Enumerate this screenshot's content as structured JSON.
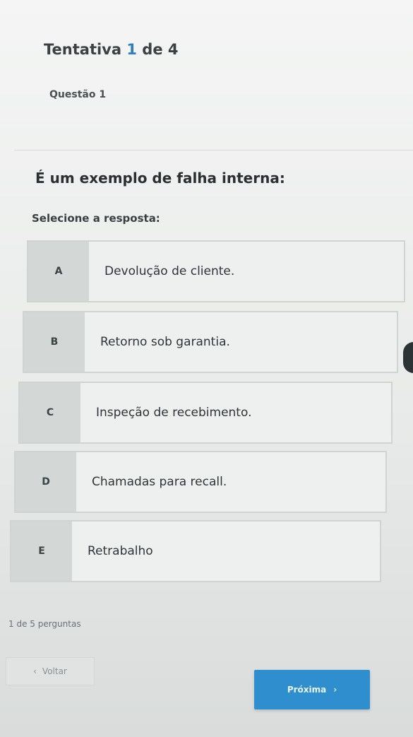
{
  "header": {
    "attempt_prefix": "Tentativa ",
    "attempt_current": "1",
    "attempt_suffix": " de 4",
    "question_label": "Questão 1"
  },
  "question": {
    "text": "É um exemplo de falha interna:",
    "instruction": "Selecione a resposta:"
  },
  "options": [
    {
      "letter": "A",
      "text": "Devolução de cliente."
    },
    {
      "letter": "B",
      "text": "Retorno sob garantia."
    },
    {
      "letter": "C",
      "text": "Inspeção de recebimento."
    },
    {
      "letter": "D",
      "text": "Chamadas para recall."
    },
    {
      "letter": "E",
      "text": "Retrabalho"
    }
  ],
  "footer": {
    "progress": "1 de 5 perguntas",
    "back_label": "Voltar",
    "back_icon": "chevron-left-icon",
    "next_label": "Próxima",
    "next_icon": "chevron-right-icon"
  },
  "colors": {
    "accent": "#2f8fce",
    "option_bg": "#eef0ef",
    "letter_bg": "#d3d8d7"
  }
}
